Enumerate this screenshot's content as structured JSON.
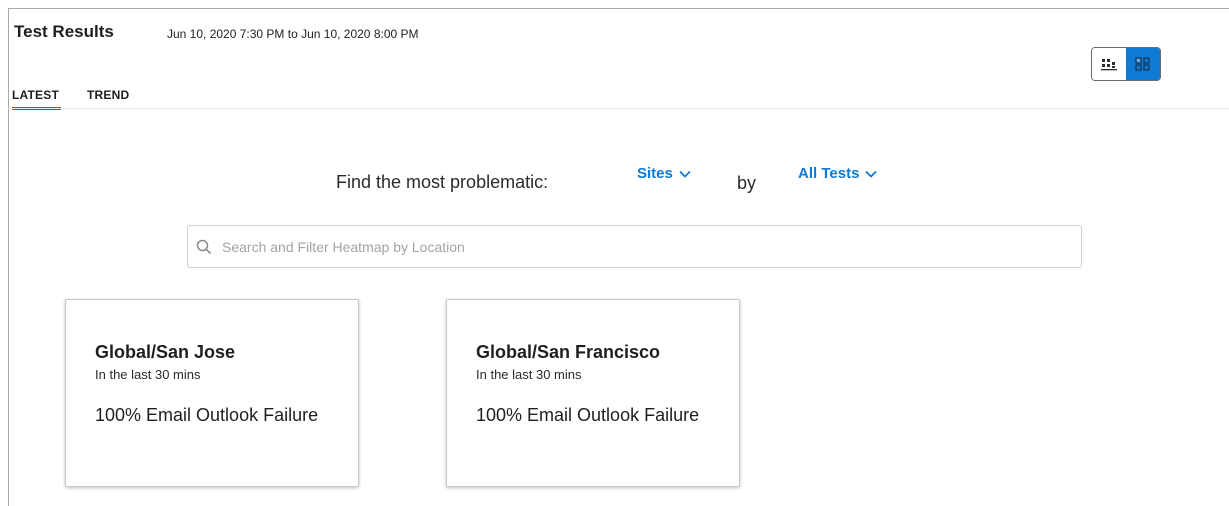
{
  "header": {
    "title": "Test Results",
    "date_range": "Jun 10, 2020 7:30 PM to Jun 10, 2020 8:00 PM"
  },
  "view_toggle": {
    "options": [
      {
        "icon": "chart-view-icon",
        "active": false
      },
      {
        "icon": "grid-view-icon",
        "active": true
      }
    ],
    "active_color": "#0d7ad6"
  },
  "tabs": [
    {
      "label": "LATEST",
      "active": true
    },
    {
      "label": "TREND",
      "active": false
    }
  ],
  "finder": {
    "prefix": "Find the most problematic:",
    "dimension": "Sites",
    "joiner": "by",
    "metric": "All Tests"
  },
  "search": {
    "placeholder": "Search and Filter Heatmap by Location",
    "value": ""
  },
  "cards": [
    {
      "title": "Global/San Jose",
      "subtitle": "In the last 30 mins",
      "metric": "100% Email Outlook Failure"
    },
    {
      "title": "Global/San Francisco",
      "subtitle": "In the last 30 mins",
      "metric": "100% Email Outlook Failure"
    }
  ]
}
